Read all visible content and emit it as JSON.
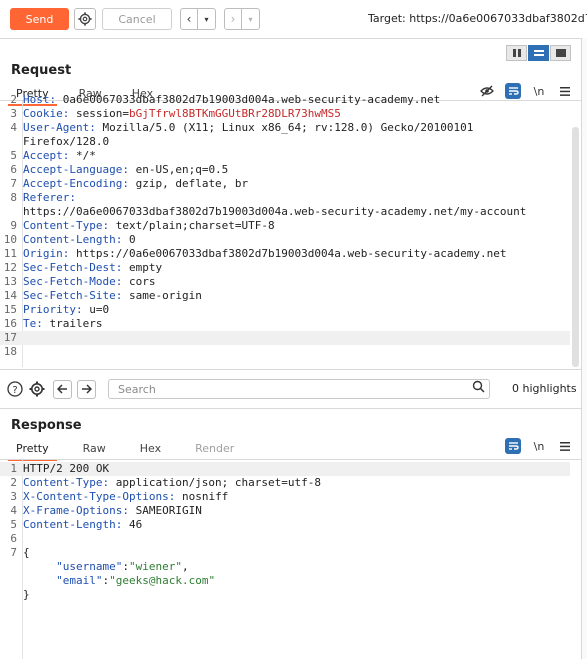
{
  "toolbar": {
    "send_label": "Send",
    "cancel_label": "Cancel",
    "target_text": "Target: https://0a6e0067033dbaf3802d7b"
  },
  "request": {
    "title": "Request",
    "tabs": [
      "Pretty",
      "Raw",
      "Hex"
    ],
    "lines": [
      {
        "n": "2",
        "key": "Host:",
        "val": " 0a6e0067033dbaf3802d7b19003d004a.web-security-academy.net"
      },
      {
        "n": "3",
        "key": "Cookie:",
        "val": " session=",
        "str": "bGjTfrwl8BTKmGGUtBRr28DLR73hwMS5"
      },
      {
        "n": "4",
        "key": "User-Agent:",
        "val": " Mozilla/5.0 (X11; Linux x86_64; rv:128.0) Gecko/20100101"
      },
      {
        "n": "",
        "key": "",
        "val": "Firefox/128.0"
      },
      {
        "n": "5",
        "key": "Accept:",
        "val": " */*"
      },
      {
        "n": "6",
        "key": "Accept-Language:",
        "val": " en-US,en;q=0.5"
      },
      {
        "n": "7",
        "key": "Accept-Encoding:",
        "val": " gzip, deflate, br"
      },
      {
        "n": "8",
        "key": "Referer:",
        "val": ""
      },
      {
        "n": "",
        "key": "",
        "val": "https://0a6e0067033dbaf3802d7b19003d004a.web-security-academy.net/my-account"
      },
      {
        "n": "9",
        "key": "Content-Type:",
        "val": " text/plain;charset=UTF-8"
      },
      {
        "n": "10",
        "key": "Content-Length:",
        "val": " 0"
      },
      {
        "n": "11",
        "key": "Origin:",
        "val": " https://0a6e0067033dbaf3802d7b19003d004a.web-security-academy.net"
      },
      {
        "n": "12",
        "key": "Sec-Fetch-Dest:",
        "val": " empty"
      },
      {
        "n": "13",
        "key": "Sec-Fetch-Mode:",
        "val": " cors"
      },
      {
        "n": "14",
        "key": "Sec-Fetch-Site:",
        "val": " same-origin"
      },
      {
        "n": "15",
        "key": "Priority:",
        "val": " u=0"
      },
      {
        "n": "16",
        "key": "Te:",
        "val": " trailers"
      },
      {
        "n": "17",
        "key": "",
        "val": ""
      },
      {
        "n": "18",
        "key": "",
        "val": ""
      }
    ]
  },
  "search": {
    "placeholder": "Search",
    "highlights": "0 highlights"
  },
  "response": {
    "title": "Response",
    "tabs": [
      "Pretty",
      "Raw",
      "Hex",
      "Render"
    ],
    "lines": [
      {
        "n": "1",
        "key": "",
        "val": "HTTP/2 200 OK"
      },
      {
        "n": "2",
        "key": "Content-Type:",
        "val": " application/json; charset=utf-8"
      },
      {
        "n": "3",
        "key": "X-Content-Type-Options:",
        "val": " nosniff"
      },
      {
        "n": "4",
        "key": "X-Frame-Options:",
        "val": " SAMEORIGIN"
      },
      {
        "n": "5",
        "key": "Content-Length:",
        "val": " 46"
      },
      {
        "n": "6",
        "key": "",
        "val": ""
      },
      {
        "n": "7",
        "key": "",
        "val": "{"
      },
      {
        "n": "",
        "json": true,
        "jkey": "\"username\"",
        "jval": "\"wiener\"",
        "trail": ","
      },
      {
        "n": "",
        "json": true,
        "jkey": "\"email\"",
        "jval": "\"geeks@hack.com\"",
        "trail": ""
      },
      {
        "n": "",
        "key": "",
        "val": "}"
      }
    ]
  },
  "colors": {
    "accent": "#ff6633",
    "header_key": "#1e4fb0",
    "cookie_value": "#c62828",
    "json_string": "#2e7d32",
    "toggle_active": "#2f6fb3"
  }
}
